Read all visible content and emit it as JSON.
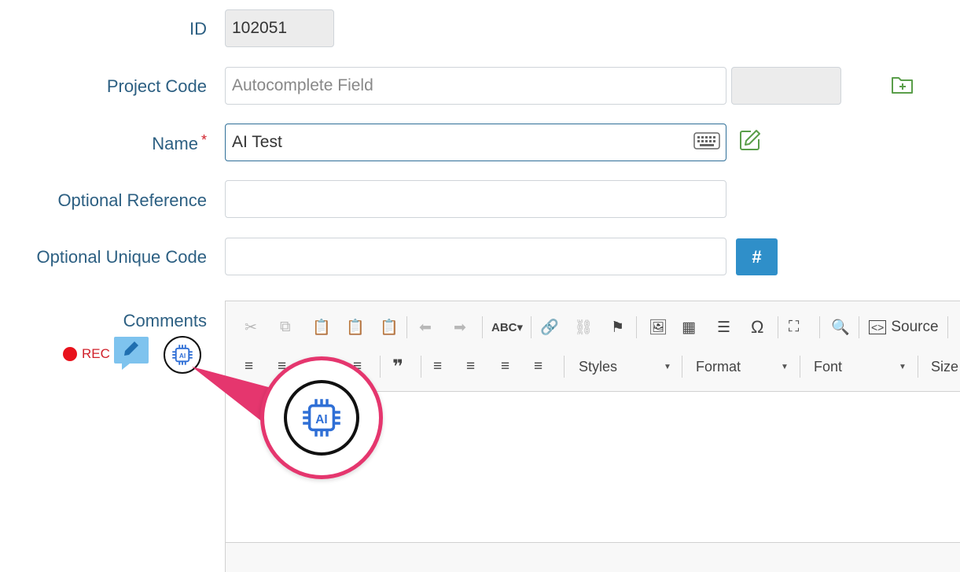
{
  "form": {
    "id": {
      "label": "ID",
      "value": "102051"
    },
    "project_code": {
      "label": "Project Code",
      "placeholder": "Autocomplete Field",
      "add_icon": "folder-plus-icon"
    },
    "name": {
      "label": "Name",
      "required_mark": "*",
      "value": "AI Test",
      "keyboard_icon": "keyboard-icon",
      "edit_icon": "edit-icon"
    },
    "optional_reference": {
      "label": "Optional Reference",
      "value": ""
    },
    "optional_unique_code": {
      "label": "Optional Unique Code",
      "value": "",
      "generate_label": "#"
    },
    "comments": {
      "label": "Comments",
      "rec_label": "REC",
      "chat_icon": "chat-pencil-icon",
      "ai_icon": "ai-chip-icon"
    }
  },
  "editor": {
    "source_label": "Source",
    "styles_label": "Styles",
    "format_label": "Format",
    "font_label": "Font",
    "size_label": "Size",
    "quote_glyph": "❞"
  },
  "callout": {
    "highlight_color": "#e5366e",
    "icon": "ai-chip-icon"
  },
  "colors": {
    "label": "#2c5f82",
    "accent": "#2f8fc9",
    "required": "#d0202a",
    "icon_green": "#5a9e4a"
  }
}
